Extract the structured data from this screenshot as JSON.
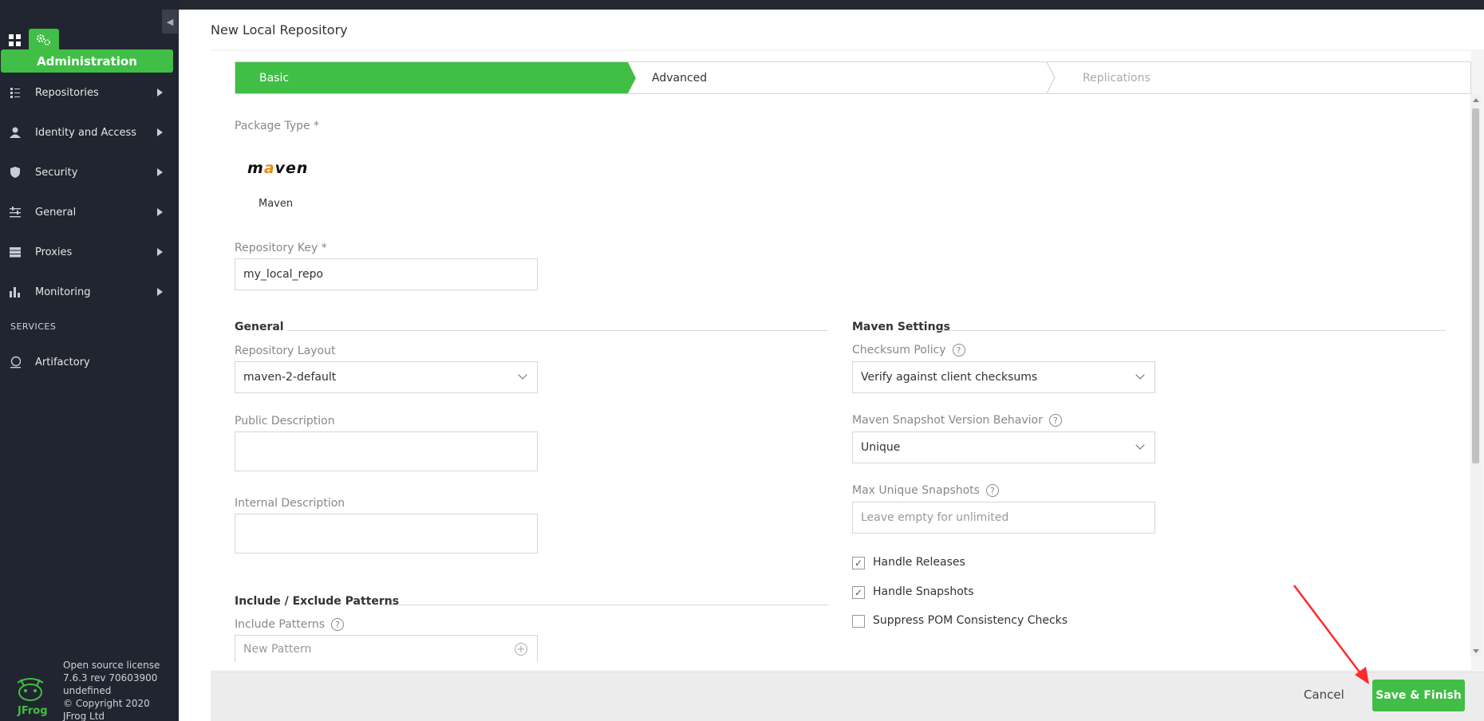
{
  "sidebar": {
    "admin_label": "Administration",
    "items": [
      {
        "label": "Repositories"
      },
      {
        "label": "Identity and Access"
      },
      {
        "label": "Security"
      },
      {
        "label": "General"
      },
      {
        "label": "Proxies"
      },
      {
        "label": "Monitoring"
      }
    ],
    "services_label": "SERVICES",
    "service_items": [
      {
        "label": "Artifactory"
      }
    ],
    "footer": {
      "line1": "Open source license",
      "line2": "7.6.3 rev 70603900",
      "line3": "undefined",
      "line4": "© Copyright 2020",
      "line5": "JFrog Ltd",
      "logo_text": "JFrog"
    }
  },
  "page": {
    "title": "New Local Repository"
  },
  "steps": {
    "basic": "Basic",
    "advanced": "Advanced",
    "replications": "Replications"
  },
  "form": {
    "package_type_label": "Package Type *",
    "package_logo_m": "m",
    "package_logo_a": "a",
    "package_logo_rest": "ven",
    "package_name": "Maven",
    "repo_key_label": "Repository Key *",
    "repo_key_value": "my_local_repo",
    "general_title": "General",
    "layout_label": "Repository Layout",
    "layout_value": "maven-2-default",
    "public_desc_label": "Public Description",
    "internal_desc_label": "Internal Description",
    "patterns_title": "Include / Exclude Patterns",
    "include_label": "Include Patterns",
    "include_placeholder": "New Pattern",
    "maven_title": "Maven Settings",
    "checksum_label": "Checksum Policy",
    "checksum_value": "Verify against client checksums",
    "snapshot_behavior_label": "Maven Snapshot Version Behavior",
    "snapshot_behavior_value": "Unique",
    "max_snapshots_label": "Max Unique Snapshots",
    "max_snapshots_placeholder": "Leave empty for unlimited",
    "handle_releases": "Handle Releases",
    "handle_releases_checked": true,
    "handle_snapshots": "Handle Snapshots",
    "handle_snapshots_checked": true,
    "suppress_pom": "Suppress POM Consistency Checks",
    "suppress_pom_checked": false,
    "help_glyph": "?",
    "check_glyph": "✓",
    "plus_glyph": "+"
  },
  "footer": {
    "cancel_label": "Cancel",
    "save_label": "Save & Finish"
  },
  "colors": {
    "accent": "#40be46",
    "sidebar_bg": "#21252f",
    "annotation": "#ff2a2a"
  }
}
